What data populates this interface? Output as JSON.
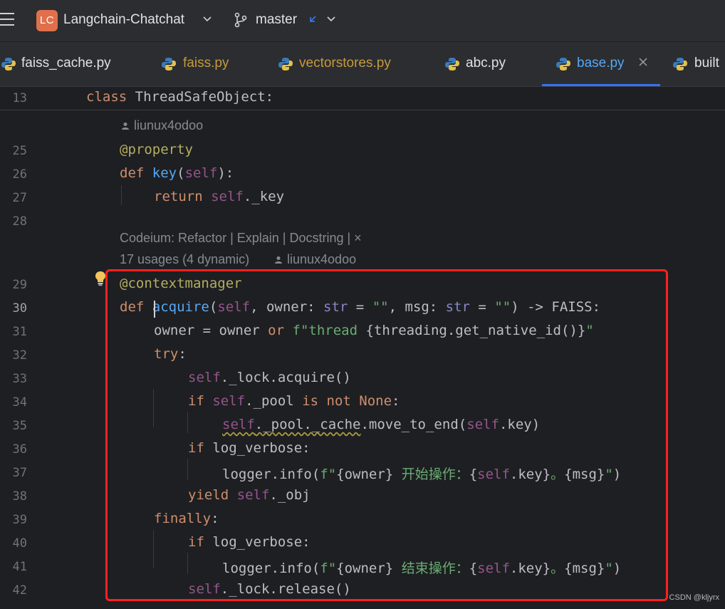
{
  "titlebar": {
    "project_initials": "LC",
    "project_name": "Langchain-Chatchat",
    "branch": "master"
  },
  "tabs": [
    {
      "label": "faiss_cache.py",
      "active": false
    },
    {
      "label": "faiss.py",
      "active": false
    },
    {
      "label": "vectorstores.py",
      "active": false
    },
    {
      "label": "abc.py",
      "active": false
    },
    {
      "label": "base.py",
      "active": true
    },
    {
      "label": "built",
      "active": false
    }
  ],
  "editor": {
    "sticky": {
      "line": "13",
      "kw": "class",
      "name": "ThreadSafeObject:"
    },
    "author_hint_1": "liunux4odoo",
    "codeium_hint": "Codeium: Refactor | Explain | Docstring | ×",
    "usages_hint": "17 usages (4 dynamic)",
    "author_hint_2": "liunux4odoo",
    "line_numbers": [
      "25",
      "26",
      "27",
      "28",
      "29",
      "30",
      "31",
      "32",
      "33",
      "34",
      "35",
      "36",
      "37",
      "38",
      "39",
      "40",
      "41",
      "42"
    ],
    "current_line": "30"
  },
  "colors": {
    "accent": "#3574f0",
    "highlight_box": "#ff2020",
    "project_badge": "#e0704c"
  },
  "watermark": "CSDN @kljyrx"
}
